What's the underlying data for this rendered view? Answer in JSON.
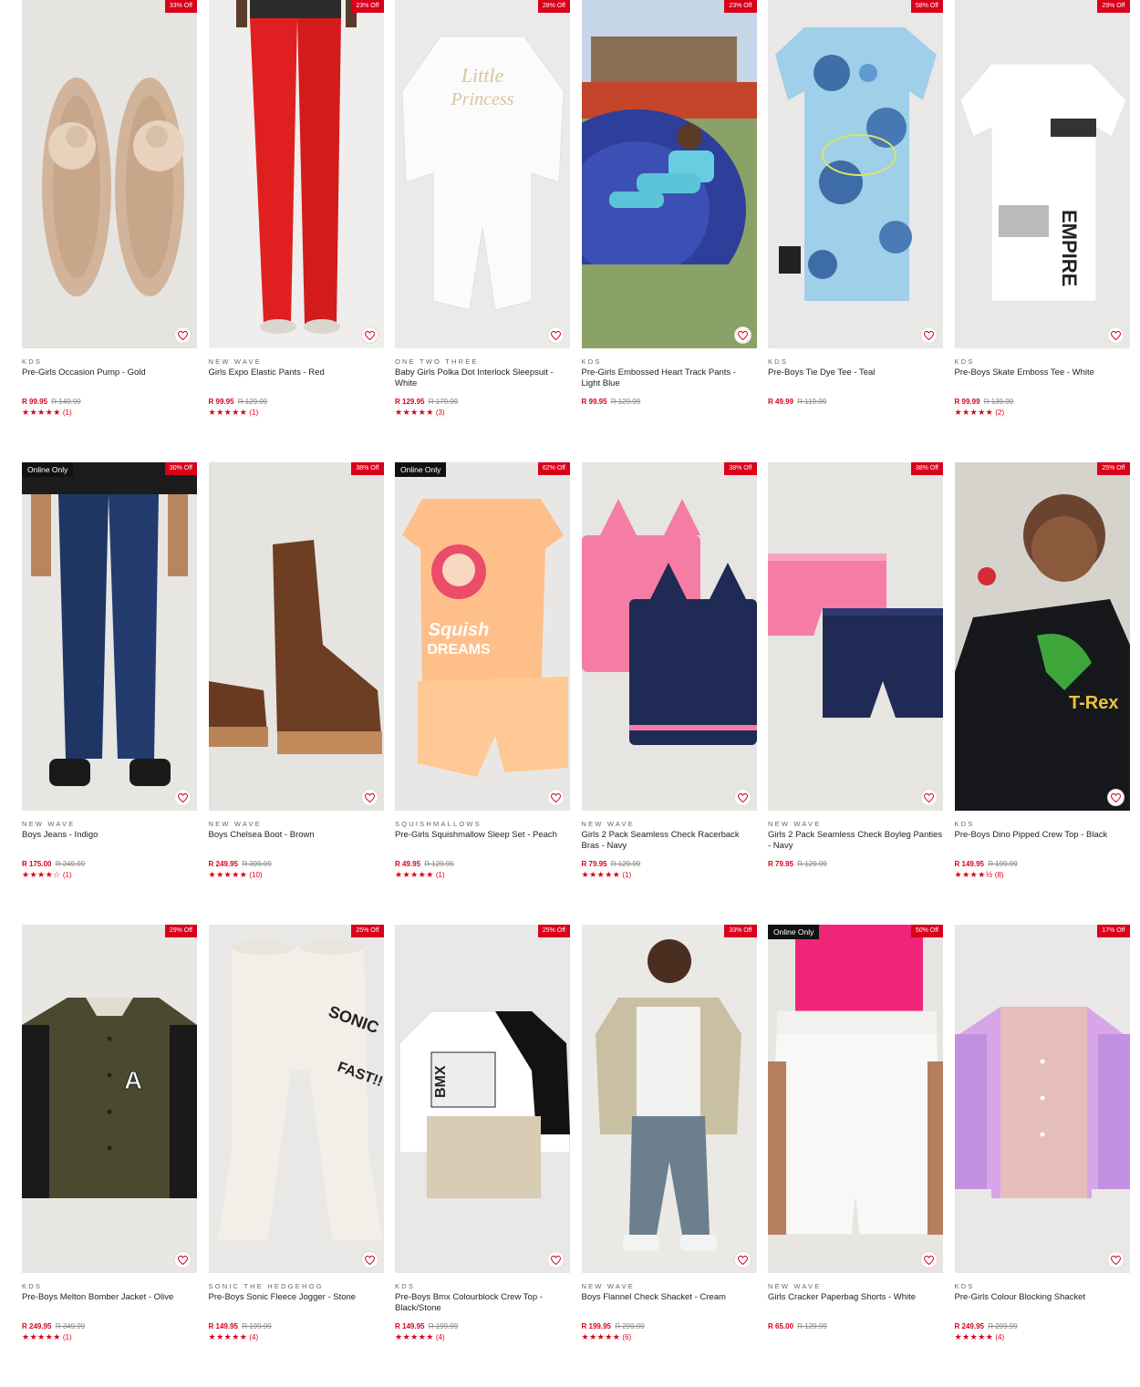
{
  "products": [
    {
      "brand": "KDS",
      "title": "Pre-Girls Occasion Pump - Gold",
      "price": "R 99.95",
      "was": "R 149.99",
      "discount": "33% Off",
      "online_only": false,
      "stars": "★★★★★",
      "reviews": "(1)",
      "bg": "#e6e4e1",
      "art": "shoes"
    },
    {
      "brand": "NEW WAVE",
      "title": "Girls Expo Elastic Pants - Red",
      "price": "R 99.95",
      "was": "R 129.99",
      "discount": "23% Off",
      "online_only": false,
      "stars": "★★★★★",
      "reviews": "(1)",
      "bg": "#efeeec",
      "art": "pants-red"
    },
    {
      "brand": "ONE TWO THREE",
      "title": "Baby Girls Polka Dot Interlock Sleepsuit - White",
      "price": "R 129.95",
      "was": "R 179.99",
      "discount": "28% Off",
      "online_only": false,
      "stars": "★★★★★",
      "reviews": "(3)",
      "bg": "#ebeae8",
      "art": "sleepsuit"
    },
    {
      "brand": "KDS",
      "title": "Pre-Girls Embossed Heart Track Pants - Light Blue",
      "price": "R 99.95",
      "was": "R 129.99",
      "discount": "23% Off",
      "online_only": false,
      "stars": "",
      "reviews": "",
      "bg": "#8aa167",
      "art": "playground"
    },
    {
      "brand": "KDS",
      "title": "Pre-Boys Tie Dye Tee - Teal",
      "price": "R 49.99",
      "was": "R 119.99",
      "discount": "58% Off",
      "online_only": false,
      "stars": "",
      "reviews": "",
      "bg": "#e9e8e6",
      "art": "tiedye"
    },
    {
      "brand": "KDS",
      "title": "Pre-Boys Skate Emboss Tee - White",
      "price": "R 99.99",
      "was": "R 139.99",
      "discount": "29% Off",
      "online_only": false,
      "stars": "★★★★★",
      "reviews": "(2)",
      "bg": "#e9e8e6",
      "art": "tee-white"
    },
    {
      "brand": "NEW WAVE",
      "title": "Boys Jeans - Indigo",
      "price": "R 175.00",
      "was": "R 249.99",
      "discount": "30% Off",
      "online_only": true,
      "online_label": "Online Only",
      "stars": "★★★★☆",
      "reviews": "(1)",
      "bg": "#e7e6e3",
      "art": "jeans"
    },
    {
      "brand": "NEW WAVE",
      "title": "Boys Chelsea Boot - Brown",
      "price": "R 249.95",
      "was": "R 399.99",
      "discount": "38% Off",
      "online_only": false,
      "stars": "★★★★★",
      "reviews": "(10)",
      "bg": "#e6e4e1",
      "art": "boots"
    },
    {
      "brand": "SQUISHMALLOWS",
      "title": "Pre-Girls Squishmallow Sleep Set - Peach",
      "price": "R 49.95",
      "was": "R 129.95",
      "discount": "62% Off",
      "online_only": true,
      "online_label": "Online Only",
      "stars": "★★★★★",
      "reviews": "(1)",
      "bg": "#e8e7e5",
      "art": "sleepset"
    },
    {
      "brand": "NEW WAVE",
      "title": "Girls 2 Pack Seamless Check Racerback Bras - Navy",
      "price": "R 79.95",
      "was": "R 129.99",
      "discount": "38% Off",
      "online_only": false,
      "stars": "★★★★★",
      "reviews": "(1)",
      "bg": "#e6e5e2",
      "art": "bras"
    },
    {
      "brand": "NEW WAVE",
      "title": "Girls 2 Pack Seamless Check Boyleg Panties - Navy",
      "price": "R 79.95",
      "was": "R 129.99",
      "discount": "38% Off",
      "online_only": false,
      "stars": "",
      "reviews": "",
      "bg": "#e6e5e2",
      "art": "panties"
    },
    {
      "brand": "KDS",
      "title": "Pre-Boys Dino Pipped Crew Top - Black",
      "price": "R 149.95",
      "was": "R 199.99",
      "discount": "25% Off",
      "online_only": false,
      "stars": "★★★★½",
      "reviews": "(8)",
      "bg": "#e4e2dc",
      "art": "dino"
    },
    {
      "brand": "KDS",
      "title": "Pre-Boys Melton Bomber Jacket - Olive",
      "price": "R 249.95",
      "was": "R 349.99",
      "discount": "29% Off",
      "online_only": false,
      "stars": "★★★★★",
      "reviews": "(1)",
      "bg": "#e8e7e4",
      "art": "bomber"
    },
    {
      "brand": "SONIC THE HEDGEHOG",
      "title": "Pre-Boys Sonic Fleece Jogger - Stone",
      "price": "R 149.95",
      "was": "R 199.99",
      "discount": "25% Off",
      "online_only": false,
      "stars": "★★★★★",
      "reviews": "(4)",
      "bg": "#e9e8e6",
      "art": "jogger"
    },
    {
      "brand": "KDS",
      "title": "Pre-Boys Bmx Colourblock Crew Top - Black/Stone",
      "price": "R 149.95",
      "was": "R 199.99",
      "discount": "25% Off",
      "online_only": false,
      "stars": "★★★★★",
      "reviews": "(4)",
      "bg": "#e9e8e6",
      "art": "bmx"
    },
    {
      "brand": "NEW WAVE",
      "title": "Boys Flannel Check Shacket - Cream",
      "price": "R 199.95",
      "was": "R 299.99",
      "discount": "33% Off",
      "online_only": false,
      "stars": "★★★★★",
      "reviews": "(6)",
      "bg": "#eae9e6",
      "art": "shacket-boy"
    },
    {
      "brand": "NEW WAVE",
      "title": "Girls Cracker Paperbag Shorts - White",
      "price": "R 65.00",
      "was": "R 129.99",
      "discount": "50% Off",
      "online_only": true,
      "online_label": "Online Only",
      "stars": "",
      "reviews": "",
      "bg": "#e7e5e2",
      "art": "shorts"
    },
    {
      "brand": "KDS",
      "title": "Pre-Girls Colour Blocking Shacket",
      "price": "R 249.95",
      "was": "R 299.99",
      "discount": "17% Off",
      "online_only": false,
      "stars": "★★★★★",
      "reviews": "(4)",
      "bg": "#e9e8e6",
      "art": "shacket-girl"
    }
  ],
  "icons": {
    "wishlist": "heart-outline-icon"
  },
  "colors": {
    "accent": "#d9001b",
    "badge_dark": "#111111"
  }
}
